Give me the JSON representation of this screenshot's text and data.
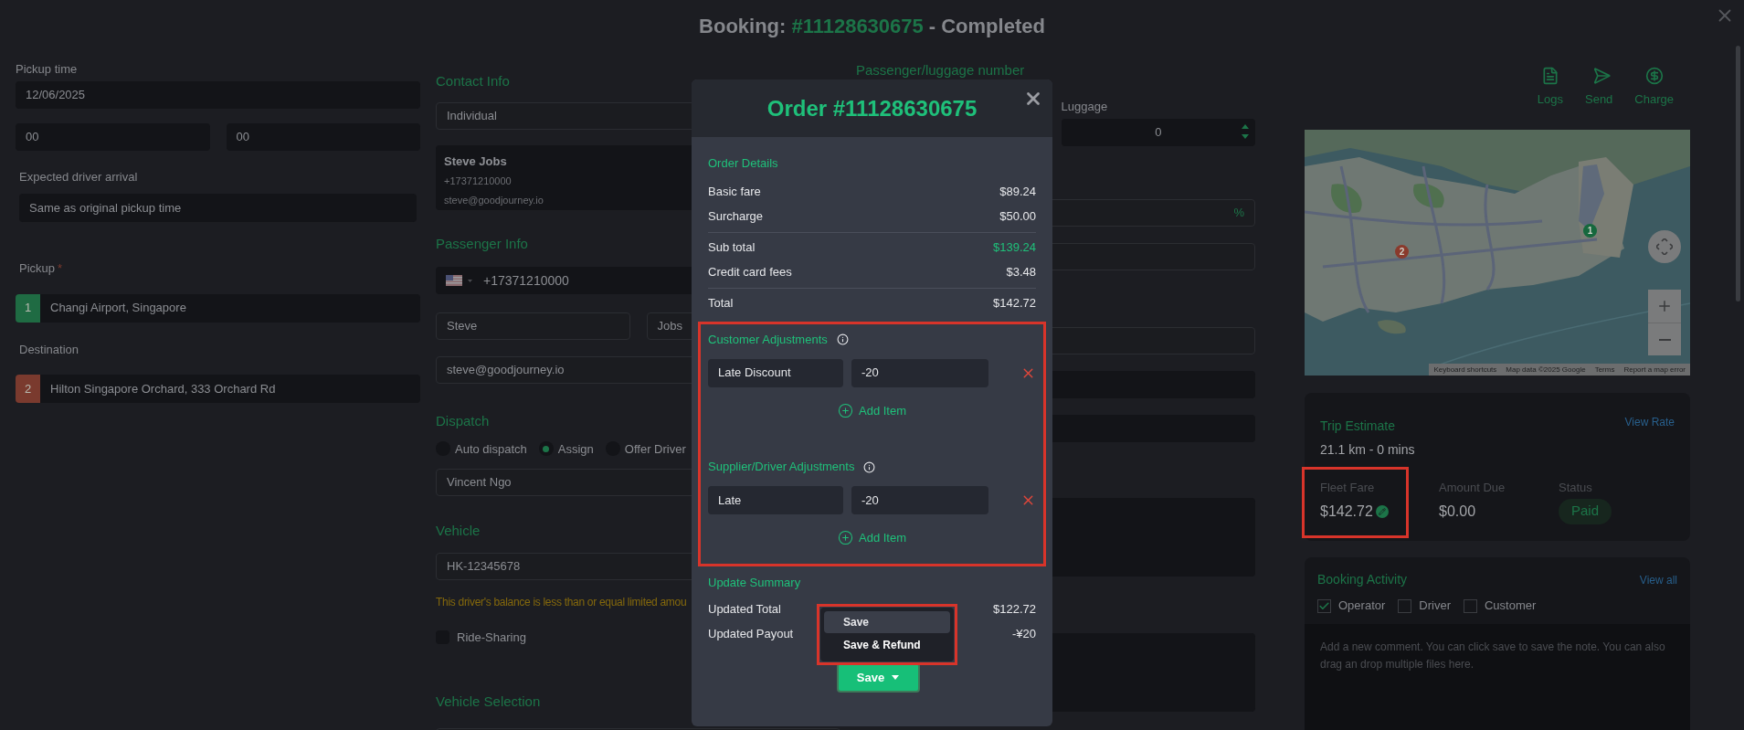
{
  "title": {
    "prefix": "Booking:",
    "number": "#11128630675",
    "status": "- Completed"
  },
  "pickup_time": {
    "label": "Pickup time",
    "date": "12/06/2025",
    "hour": "00",
    "minute": "00"
  },
  "expected_arrival": {
    "label": "Expected driver arrival",
    "value": "Same as original pickup time"
  },
  "locations": [
    {
      "label": "Pickup",
      "required_mark": "*",
      "number": "1",
      "address": "Changi Airport, Singapore",
      "color": "#1f6b43"
    },
    {
      "label": "Destination",
      "number": "2",
      "address": "Hilton Singapore Orchard, 333 Orchard Rd",
      "color": "#7a3a2e"
    }
  ],
  "contact_info": {
    "heading": "Contact Info",
    "type": "Individual",
    "name": "Steve Jobs",
    "phone": "+17371210000",
    "email": "steve@goodjourney.io"
  },
  "passenger_info": {
    "heading": "Passenger Info",
    "phone": "+17371210000",
    "first_name": "Steve",
    "last_name": "Jobs",
    "email": "steve@goodjourney.io"
  },
  "dispatch": {
    "heading": "Dispatch",
    "options": [
      {
        "label": "Auto dispatch",
        "selected": false
      },
      {
        "label": "Assign",
        "selected": true
      },
      {
        "label": "Offer Driver",
        "selected": false
      }
    ],
    "driver": "Vincent Ngo"
  },
  "vehicle": {
    "heading": "Vehicle",
    "plate": "HK-12345678",
    "warning": "This driver's balance is less than or equal limited amou",
    "ride_sharing": {
      "label": "Ride-Sharing",
      "checked": false
    }
  },
  "vehicle_selection": {
    "heading": "Vehicle Selection"
  },
  "passenger_luggage": {
    "heading": "Passenger/luggage number",
    "luggage_label": "Luggage",
    "luggage": "0",
    "percent_suffix": "%"
  },
  "actions": [
    {
      "label": "Logs",
      "kind": "logs"
    },
    {
      "label": "Send",
      "kind": "send"
    },
    {
      "label": "Charge",
      "kind": "charge"
    }
  ],
  "map": {
    "markers": [
      {
        "number": "1",
        "color": "#16683d"
      },
      {
        "number": "2",
        "color": "#8a3a2c"
      }
    ],
    "footer": [
      "Keyboard shortcuts",
      "Map data ©2025 Google",
      "Terms",
      "Report a map error"
    ]
  },
  "trip_estimate": {
    "heading": "Trip Estimate",
    "link": "View Rate",
    "summary": "21.1 km - 0 mins",
    "stats": [
      {
        "label": "Fleet Fare",
        "value": "$142.72",
        "kind": "editable",
        "highlighted": true
      },
      {
        "label": "Amount Due",
        "value": "$0.00",
        "kind": "plain",
        "highlighted": false
      },
      {
        "label": "Status",
        "value": "Paid",
        "kind": "badge",
        "highlighted": false
      }
    ]
  },
  "booking_activity": {
    "heading": "Booking Activity",
    "link": "View all",
    "filters": [
      {
        "label": "Operator",
        "checked": true
      },
      {
        "label": "Driver",
        "checked": false
      },
      {
        "label": "Customer",
        "checked": false
      }
    ],
    "comment_placeholder": "Add a new comment. You can click save to save the note. You can also drag an drop multiple files here."
  },
  "order_modal": {
    "title": "Order #11128630675",
    "details_heading": "Order Details",
    "groups": [
      {
        "lines": [
          {
            "label": "Basic fare",
            "value": "$89.24",
            "accent": false
          },
          {
            "label": "Surcharge",
            "value": "$50.00",
            "accent": false
          }
        ]
      },
      {
        "lines": [
          {
            "label": "Sub total",
            "value": "$139.24",
            "accent": true
          },
          {
            "label": "Credit card fees",
            "value": "$3.48",
            "accent": false
          }
        ]
      },
      {
        "lines": [
          {
            "label": "Total",
            "value": "$142.72",
            "accent": false
          }
        ]
      }
    ],
    "adjustments_highlighted": true,
    "adjustment_sections": [
      {
        "heading": "Customer Adjustments",
        "items": [
          {
            "name": "Late Discount",
            "amount": "-20"
          }
        ],
        "add_label": "Add Item"
      },
      {
        "heading": "Supplier/Driver Adjustments",
        "items": [
          {
            "name": "Late",
            "amount": "-20"
          }
        ],
        "add_label": "Add Item"
      }
    ],
    "summary": {
      "heading": "Update Summary",
      "lines": [
        {
          "label": "Updated Total",
          "value": "$122.72"
        },
        {
          "label": "Updated Payout",
          "value": "-¥20"
        }
      ]
    },
    "save_menu": {
      "highlighted": true,
      "items": [
        {
          "label": "Save",
          "selected": true
        },
        {
          "label": "Save & Refund",
          "selected": false
        }
      ]
    },
    "save_button": "Save"
  }
}
